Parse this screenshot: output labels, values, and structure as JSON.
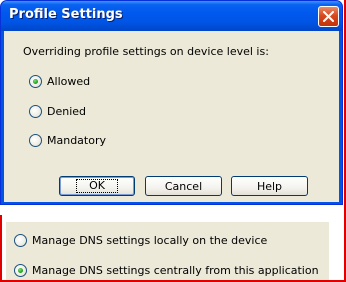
{
  "dialog": {
    "title": "Profile Settings",
    "prompt": "Overriding profile settings on device level is:",
    "options": [
      {
        "label": "Allowed",
        "checked": true
      },
      {
        "label": "Denied",
        "checked": false
      },
      {
        "label": "Mandatory",
        "checked": false
      }
    ],
    "buttons": {
      "ok": "OK",
      "cancel": "Cancel",
      "help": "Help"
    }
  },
  "dns": {
    "options": [
      {
        "label": "Manage DNS settings locally on the device",
        "checked": false
      },
      {
        "label": "Manage DNS settings centrally from this application",
        "checked": true
      }
    ]
  },
  "colors": {
    "titlebar": "#0055e5",
    "dialog_face": "#ece9d8",
    "close_button": "#d9491f",
    "highlight_border": "#e00000",
    "radio_dot": "#21a121"
  }
}
